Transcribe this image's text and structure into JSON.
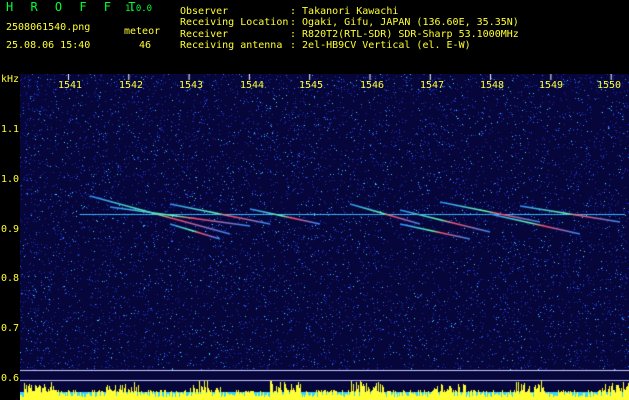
{
  "header": {
    "app_title": "H R O F F T",
    "version": "1.0.0",
    "filename": "2508061540.png",
    "datetime": "25.08.06 15:40",
    "count_label": "meteor",
    "count_value": "46",
    "observer_label": "Observer",
    "observer_value": ": Takanori Kawachi",
    "location_label": "Receiving Location",
    "location_value": ": Ogaki, Gifu, JAPAN (136.60E, 35.35N)",
    "receiver_label": "Receiver",
    "receiver_value": ": R820T2(RTL-SDR) SDR-Sharp 53.1000MHz",
    "antenna_label": "Receiving antenna",
    "antenna_value": ": 2el-HB9CV Vertical (el. E-W)"
  },
  "axis": {
    "unit": "kHz",
    "time_ticks": [
      "1541",
      "1542",
      "1543",
      "1544",
      "1545",
      "1546",
      "1547",
      "1548",
      "1549",
      "1550"
    ],
    "freq_ticks": [
      "1.1",
      "1.0",
      "0.9",
      "0.8",
      "0.7",
      "0.6"
    ]
  },
  "colors": {
    "label_yellow": "#ffff33",
    "title_green": "#00ff33",
    "background": "#06063a"
  }
}
